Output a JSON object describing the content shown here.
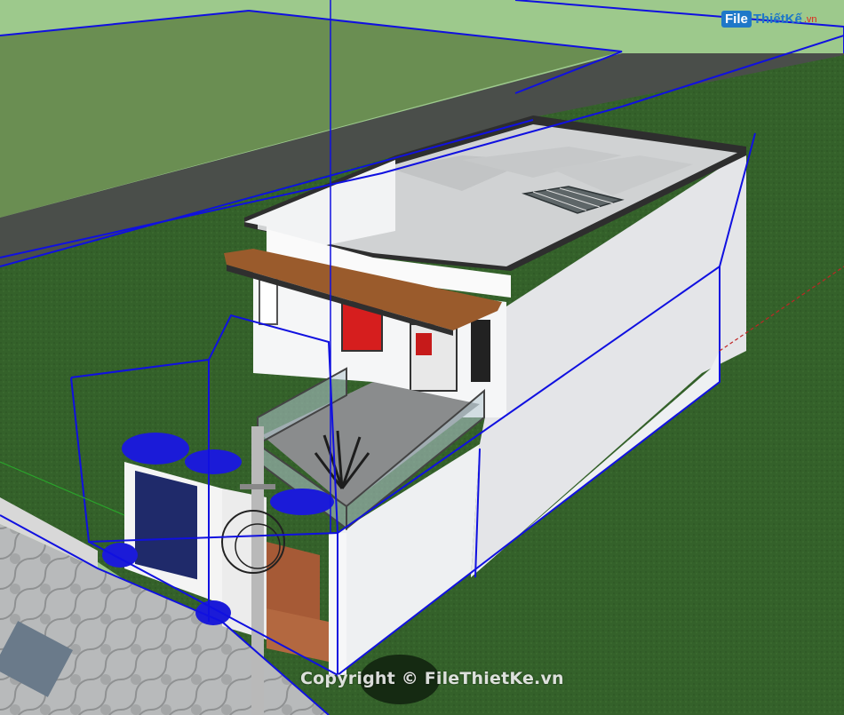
{
  "brand": {
    "logo_file": "File",
    "logo_rest": "ThiếtKế",
    "logo_domain": ".vn"
  },
  "watermark": "Copyright © FileThietKe.vn",
  "colors": {
    "sky_ground": "#9dc98c",
    "grass": "#34612a",
    "road": "#4a4e4a",
    "wall": "#f4f5f7",
    "roof": "#cfd1d2",
    "wood": "#9a5b2c",
    "selection": "#1010e0",
    "paving": "#b8babb"
  }
}
